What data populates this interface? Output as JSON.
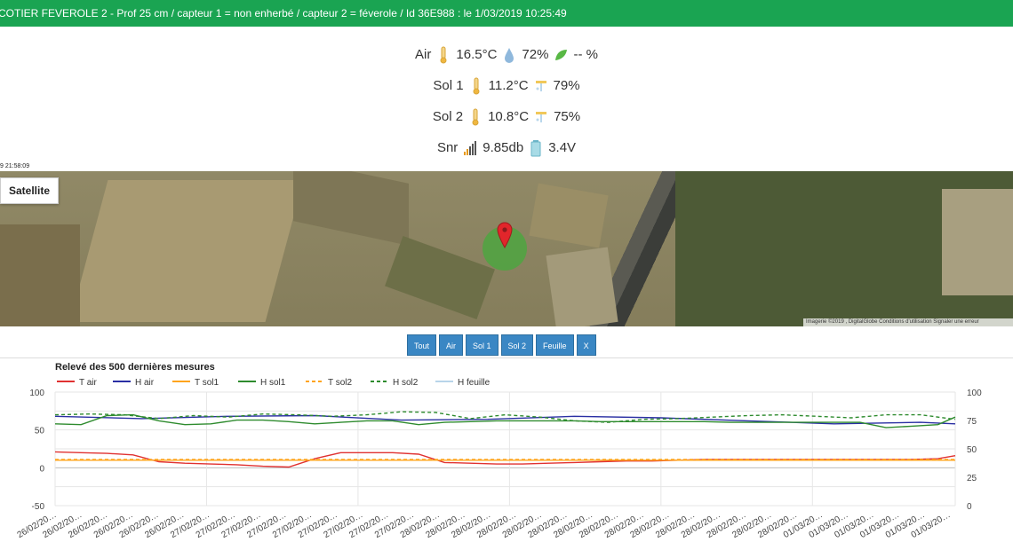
{
  "header": {
    "title": "COTIER FEVEROLE 2 - Prof 25 cm / capteur 1 = non enherbé / capteur 2 = féverole / Id 36E988 : le 1/03/2019 10:25:49"
  },
  "readings": {
    "air": {
      "label": "Air",
      "temp": "16.5°C",
      "humidity": "72%",
      "leaf": "-- %"
    },
    "sol1": {
      "label": "Sol 1",
      "temp": "11.2°C",
      "humidity": "79%"
    },
    "sol2": {
      "label": "Sol 2",
      "temp": "10.8°C",
      "humidity": "75%"
    },
    "snr": {
      "label": "Snr",
      "signal": "9.85db",
      "battery": "3.4V"
    }
  },
  "map": {
    "timestamp": "9 21:58:09",
    "type_button": "Satellite",
    "attribution": "Imagerie ©2019 , DigitalGlobe    Conditions d'utilisation    Signaler une erreur"
  },
  "filter_buttons": [
    "Tout",
    "Air",
    "Sol 1",
    "Sol 2",
    "Feuille",
    "X"
  ],
  "colors": {
    "header": "#1aa452",
    "button": "#3a87c4"
  },
  "chart_data": {
    "type": "line",
    "title": "Relevé des 500 dernières mesures",
    "y_left": {
      "ticks": [
        -50,
        0,
        50,
        100
      ],
      "range": [
        -50,
        100
      ]
    },
    "y_right": {
      "ticks": [
        0,
        25,
        50,
        75,
        100
      ],
      "range": [
        0,
        100
      ]
    },
    "x_tick_labels": [
      "26/02/20…",
      "26/02/20…",
      "26/02/20…",
      "26/02/20…",
      "26/02/20…",
      "26/02/20…",
      "27/02/20…",
      "27/02/20…",
      "27/02/20…",
      "27/02/20…",
      "27/02/20…",
      "27/02/20…",
      "27/02/20…",
      "27/02/20…",
      "27/02/20…",
      "28/02/20…",
      "28/02/20…",
      "28/02/20…",
      "28/02/20…",
      "28/02/20…",
      "28/02/20…",
      "28/02/20…",
      "28/02/20…",
      "28/02/20…",
      "28/02/20…",
      "28/02/20…",
      "28/02/20…",
      "28/02/20…",
      "28/02/20…",
      "28/02/20…",
      "01/03/20…",
      "01/03/20…",
      "01/03/20…",
      "01/03/20…",
      "01/03/20…",
      "01/03/20…"
    ],
    "series": [
      {
        "name": "T air",
        "color": "#e03131",
        "dash": false,
        "axis": "left",
        "x": [
          0,
          3,
          6,
          9,
          12,
          15,
          18,
          21,
          24,
          27,
          30,
          33,
          36,
          39,
          42,
          45,
          48,
          51,
          54,
          57,
          60,
          63,
          66,
          69,
          72,
          75,
          78,
          81,
          84,
          87,
          90,
          93,
          96,
          99,
          102,
          104
        ],
        "values": [
          21,
          20,
          19,
          17,
          8,
          6,
          5,
          4,
          2,
          1,
          12,
          20,
          20,
          20,
          18,
          7,
          6,
          5,
          5,
          6,
          7,
          8,
          9,
          9,
          10,
          11,
          11,
          11,
          11,
          11,
          11,
          11,
          11,
          11,
          12,
          16
        ]
      },
      {
        "name": "H air",
        "color": "#2a2fa3",
        "dash": false,
        "axis": "left",
        "x": [
          0,
          10,
          20,
          30,
          40,
          50,
          60,
          70,
          80,
          90,
          100,
          104
        ],
        "values": [
          68,
          65,
          68,
          69,
          63,
          64,
          68,
          66,
          62,
          58,
          60,
          58
        ]
      },
      {
        "name": "T sol1",
        "color": "#ffa41b",
        "dash": false,
        "axis": "left",
        "x": [
          0,
          20,
          40,
          60,
          80,
          100,
          104
        ],
        "values": [
          10,
          10,
          10,
          10,
          10,
          10,
          10
        ]
      },
      {
        "name": "H sol1",
        "color": "#2e8b2e",
        "dash": false,
        "axis": "left",
        "x": [
          0,
          3,
          6,
          9,
          12,
          15,
          18,
          21,
          24,
          27,
          30,
          33,
          36,
          39,
          42,
          45,
          48,
          51,
          54,
          57,
          60,
          63,
          66,
          69,
          72,
          75,
          78,
          81,
          84,
          87,
          90,
          93,
          96,
          99,
          102,
          104
        ],
        "values": [
          58,
          57,
          69,
          70,
          62,
          57,
          58,
          63,
          63,
          61,
          58,
          60,
          62,
          62,
          57,
          60,
          61,
          62,
          62,
          62,
          62,
          61,
          61,
          61,
          61,
          61,
          60,
          60,
          60,
          60,
          60,
          60,
          53,
          55,
          57,
          67
        ]
      },
      {
        "name": "T sol2",
        "color": "#ffa41b",
        "dash": true,
        "axis": "left",
        "x": [
          0,
          20,
          40,
          60,
          80,
          100,
          104
        ],
        "values": [
          11,
          11,
          11,
          11,
          11,
          11,
          11
        ]
      },
      {
        "name": "H sol2",
        "color": "#2e8b2e",
        "dash": true,
        "axis": "left",
        "x": [
          0,
          4,
          8,
          12,
          16,
          20,
          24,
          28,
          32,
          36,
          40,
          44,
          48,
          52,
          56,
          60,
          64,
          68,
          72,
          76,
          80,
          84,
          88,
          92,
          96,
          100,
          104
        ],
        "values": [
          70,
          71,
          70,
          65,
          69,
          67,
          71,
          70,
          68,
          70,
          74,
          73,
          65,
          70,
          67,
          62,
          60,
          64,
          65,
          67,
          69,
          70,
          68,
          66,
          70,
          70,
          64
        ]
      },
      {
        "name": "H feuille",
        "color": "#b8d4ea",
        "dash": false,
        "axis": "right",
        "x": [],
        "values": []
      }
    ]
  }
}
